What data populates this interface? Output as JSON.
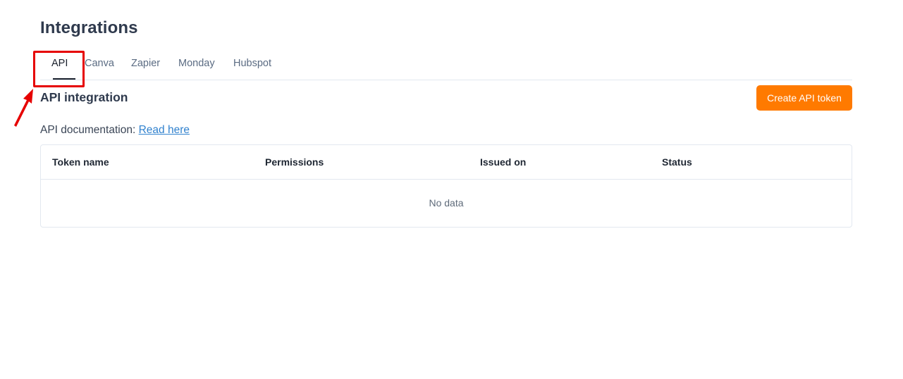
{
  "page": {
    "title": "Integrations"
  },
  "tabs": [
    {
      "label": "API",
      "active": true
    },
    {
      "label": "Canva",
      "active": false
    },
    {
      "label": "Zapier",
      "active": false
    },
    {
      "label": "Monday",
      "active": false
    },
    {
      "label": "Hubspot",
      "active": false
    }
  ],
  "section": {
    "title": "API integration",
    "create_button_label": "Create API token",
    "doc_prefix": "API documentation:",
    "doc_link_label": "Read here"
  },
  "table": {
    "columns": [
      "Token name",
      "Permissions",
      "Issued on",
      "Status"
    ],
    "rows": [],
    "empty_text": "No data"
  },
  "annotation": {
    "highlight_color": "#e60000",
    "arrow_icon": "red-pointer-arrow"
  },
  "colors": {
    "accent": "#ff7a00",
    "link": "#3182ce"
  }
}
